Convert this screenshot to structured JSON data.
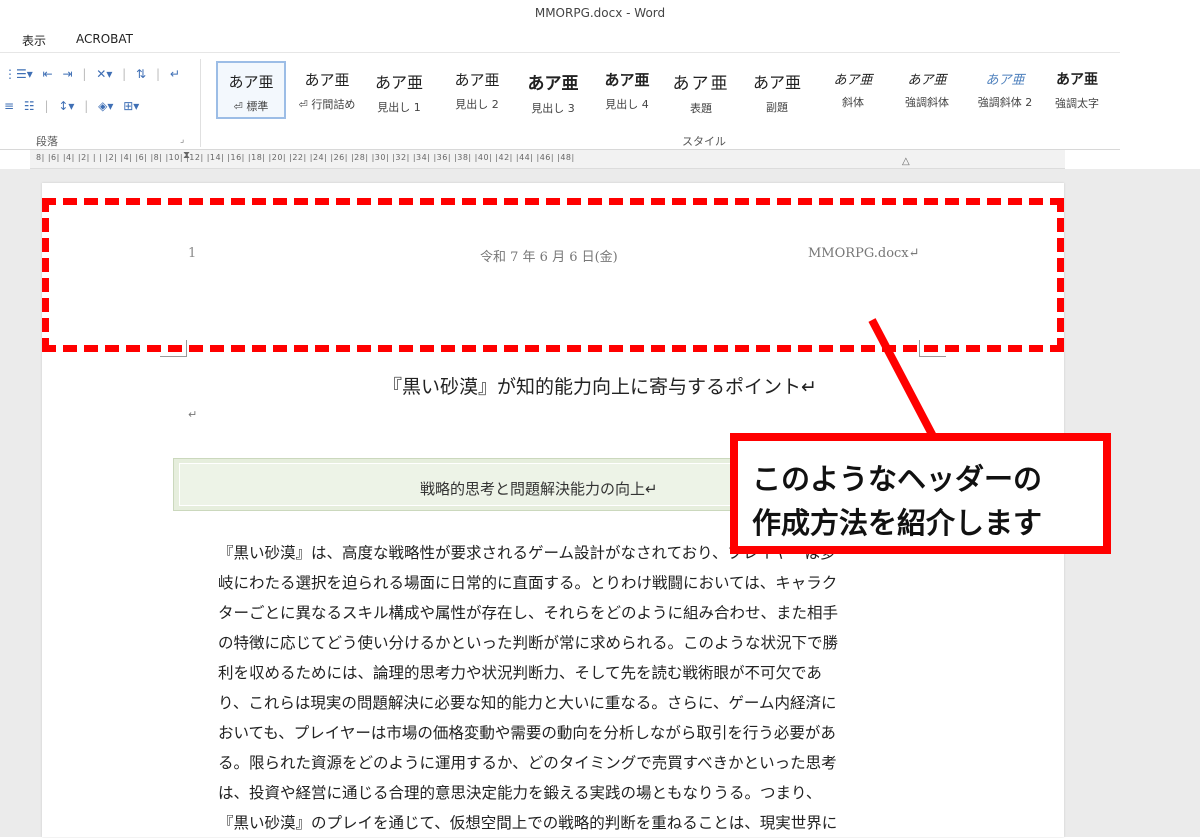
{
  "window": {
    "title": "MMORPG.docx - Word"
  },
  "menu": {
    "items": [
      "表示",
      "ACROBAT"
    ]
  },
  "ribbon": {
    "paragraph_group_label": "段落",
    "styles_group_label": "スタイル",
    "styles": [
      {
        "preview": "あア亜",
        "name": "⏎ 標準"
      },
      {
        "preview": "あア亜",
        "name": "⏎ 行間詰め"
      },
      {
        "preview": "あア亜",
        "name": "見出し 1"
      },
      {
        "preview": "あア亜",
        "name": "見出し 2"
      },
      {
        "preview": "あア亜",
        "name": "見出し 3"
      },
      {
        "preview": "あア亜",
        "name": "見出し 4"
      },
      {
        "preview": "あア亜",
        "name": "表題"
      },
      {
        "preview": "あア亜",
        "name": "副題"
      },
      {
        "preview": "あア亜",
        "name": "斜体"
      },
      {
        "preview": "あア亜",
        "name": "強調斜体"
      },
      {
        "preview": "あア亜",
        "name": "強調斜体 2"
      },
      {
        "preview": "あア亜",
        "name": "強調太字"
      }
    ]
  },
  "ruler": {
    "numbers": "8| |6| |4| |2| | | |2| |4| |6| |8| |10| |12| |14| |16| |18| |20| |22| |24| |26| |28| |30| |32| |34| |36| |38| |40| |42| |44| |46| |48|"
  },
  "document": {
    "header": {
      "page_number": "1",
      "date": "令和 7 年 6 月 6 日(金)",
      "filename": "MMORPG.docx↵"
    },
    "title": "『黒い砂漠』が知的能力向上に寄与するポイント↵",
    "para_mark": "↵",
    "section_heading": "戦略的思考と問題解決能力の向上↵",
    "body_lines": [
      "『黒い砂漠』は、高度な戦略性が要求されるゲーム設計がなされており、プレイヤーは多",
      "岐にわたる選択を迫られる場面に日常的に直面する。とりわけ戦闘においては、キャラク",
      "ターごとに異なるスキル構成や属性が存在し、それらをどのように組み合わせ、また相手",
      "の特徴に応じてどう使い分けるかといった判断が常に求められる。このような状況下で勝",
      "利を収めるためには、論理的思考力や状況判断力、そして先を読む戦術眼が不可欠であ",
      "り、これらは現実の問題解決に必要な知的能力と大いに重なる。さらに、ゲーム内経済に",
      "おいても、プレイヤーは市場の価格変動や需要の動向を分析しながら取引を行う必要があ",
      "る。限られた資源をどのように運用するか、どのタイミングで売買すべきかといった思考",
      "は、投資や経営に通じる合理的意思決定能力を鍛える実践の場ともなりうる。つまり、",
      "『黒い砂漠』のプレイを通じて、仮想空間上での戦略的判断を重ねることは、現実世界に"
    ]
  },
  "callout": {
    "line1": "このようなヘッダーの",
    "line2": "作成方法を紹介します",
    "color": "#ff0000"
  }
}
